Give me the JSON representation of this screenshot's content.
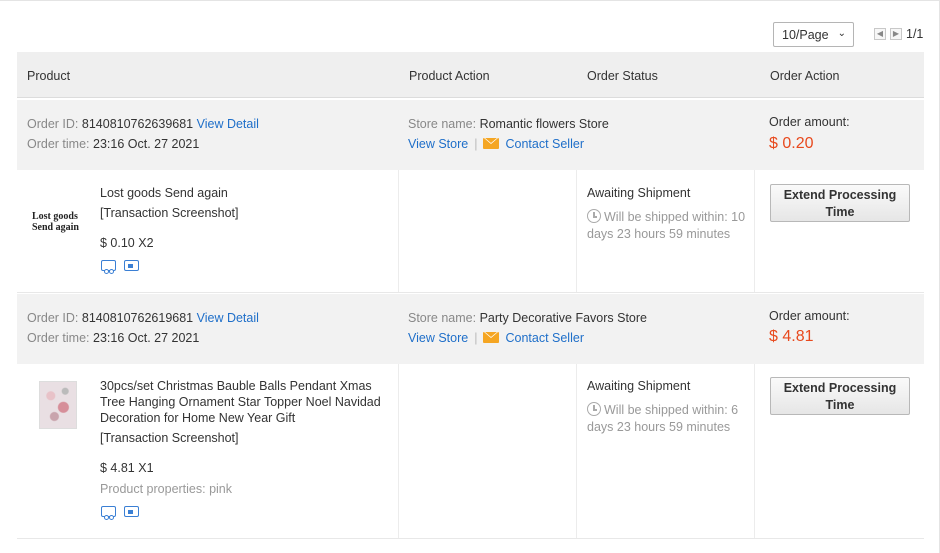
{
  "pager": {
    "page_size": "10/Page",
    "page_count": "1/1"
  },
  "columns": {
    "product": "Product",
    "product_action": "Product Action",
    "order_status": "Order Status",
    "order_action": "Order Action"
  },
  "labels": {
    "order_id": "Order ID:",
    "order_time": "Order time:",
    "view_detail": "View Detail",
    "store_name": "Store name:",
    "view_store": "View Store",
    "contact_seller": "Contact Seller",
    "order_amount": "Order amount:",
    "transaction_screenshot": "[Transaction Screenshot]",
    "extend_line1": "Extend Processing",
    "extend_line2": "Time",
    "separator": "|"
  },
  "orders": [
    {
      "id": "8140810762639681",
      "time": "23:16 Oct. 27 2021",
      "store": "Romantic flowers Store",
      "amount": "$ 0.20",
      "product_thumb_text": [
        "Lost goods",
        "Send again"
      ],
      "product_title": "Lost goods Send again",
      "price_qty": "$ 0.10 X2",
      "properties": "",
      "status": "Awaiting Shipment",
      "ship_note": "Will be shipped within: 10 days 23 hours 59 minutes"
    },
    {
      "id": "8140810762619681",
      "time": "23:16 Oct. 27 2021",
      "store": "Party Decorative Favors Store",
      "amount": "$ 4.81",
      "product_title": "30pcs/set Christmas Bauble Balls Pendant Xmas Tree Hanging Ornament Star Topper Noel Navidad Decoration for Home New Year Gift",
      "price_qty": "$ 4.81 X1",
      "properties": "Product properties: pink",
      "status": "Awaiting Shipment",
      "ship_note": "Will be shipped within: 6 days 23 hours 59 minutes"
    }
  ],
  "icons": [
    "chevron-down-icon",
    "prev-page-icon",
    "next-page-icon",
    "mail-icon",
    "clock-icon",
    "truck-icon",
    "card-icon"
  ]
}
